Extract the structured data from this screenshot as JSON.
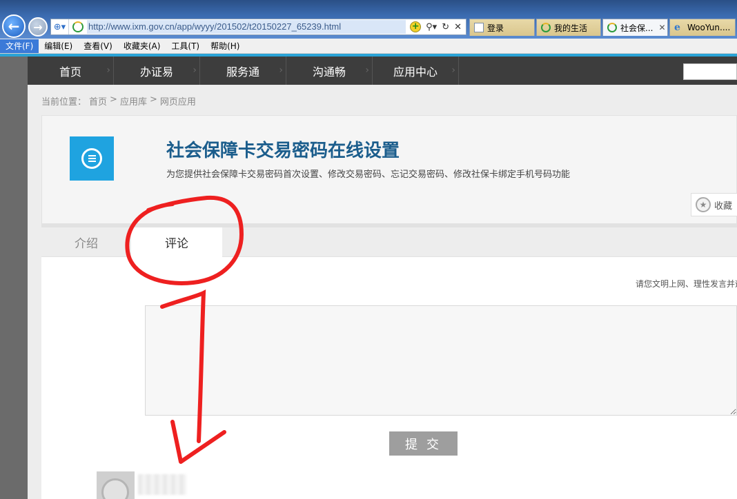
{
  "browser": {
    "url": "http://www.ixm.gov.cn/app/wyyy/201502/t20150227_65239.html",
    "tabs": [
      {
        "label": "登录",
        "icon": "document-icon",
        "active": false
      },
      {
        "label": "我的生活",
        "icon": "site-favicon",
        "active": false
      },
      {
        "label": "社会保...",
        "icon": "site-favicon",
        "active": true
      },
      {
        "label": "WooYun....",
        "icon": "ie-icon",
        "active": false
      }
    ],
    "menu": [
      "文件(F)",
      "编辑(E)",
      "查看(V)",
      "收藏夹(A)",
      "工具(T)",
      "帮助(H)"
    ],
    "active_menu_index": 0
  },
  "topnav": {
    "items": [
      "首页",
      "办证易",
      "服务通",
      "沟通畅",
      "应用中心"
    ]
  },
  "breadcrumb": {
    "prefix": "当前位置：",
    "items": [
      "首页",
      "应用库",
      "网页应用"
    ],
    "separator": ">"
  },
  "app": {
    "title": "社会保障卡交易密码在线设置",
    "description": "为您提供社会保障卡交易密码首次设置、修改交易密码、忘记交易密码、修改社保卡绑定手机号码功能",
    "favorite_label": "收藏"
  },
  "tabs": {
    "intro": "介绍",
    "comment": "评论",
    "active": "comment"
  },
  "comment": {
    "notice": "请您文明上网、理性发言并遵",
    "placeholder": "",
    "submit_label": "提 交"
  },
  "colors": {
    "nav_bg": "#3d3d3d",
    "accent_blue": "#1fa3e0",
    "title_blue": "#1b5d8c",
    "annotation_red": "#ee2020",
    "submit_gray": "#9e9e9e"
  }
}
